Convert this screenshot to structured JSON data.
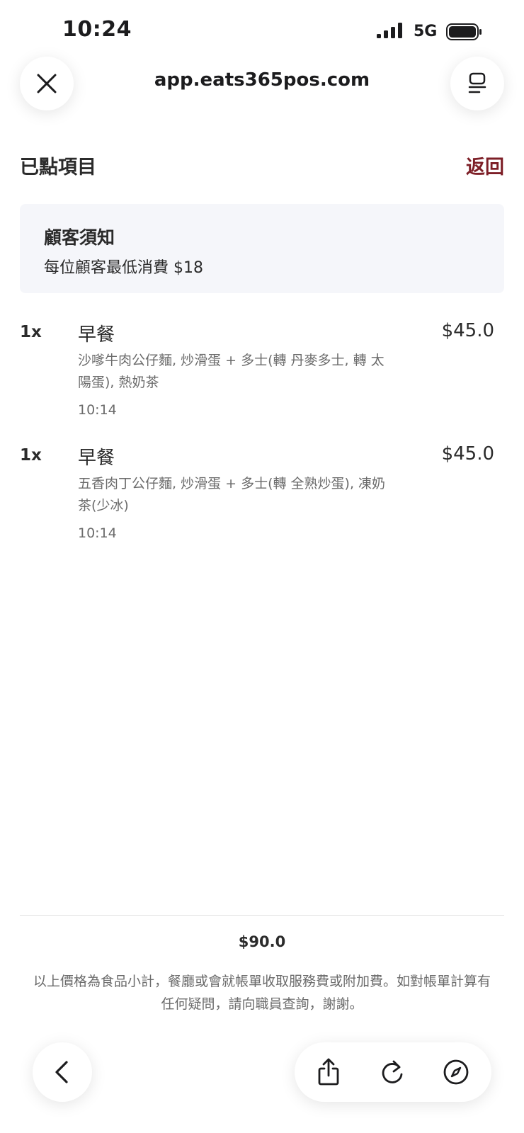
{
  "status_bar": {
    "time": "10:24",
    "network": "5G"
  },
  "browser": {
    "url": "app.eats365pos.com",
    "close_icon": "close-icon",
    "menu_icon": "page-menu-icon"
  },
  "header": {
    "title": "已點項目",
    "back_label": "返回"
  },
  "notice": {
    "title": "顧客須知",
    "text": "每位顧客最低消費 $18"
  },
  "items": [
    {
      "qty": "1x",
      "name": "早餐",
      "price": "$45.0",
      "description": "沙嗲牛肉公仔麵, 炒滑蛋 + 多士(轉 丹麥多士, 轉 太陽蛋), 熱奶茶",
      "time": "10:14"
    },
    {
      "qty": "1x",
      "name": "早餐",
      "price": "$45.0",
      "description": "五香肉丁公仔麵, 炒滑蛋 + 多士(轉 全熟炒蛋), 凍奶茶(少冰)",
      "time": "10:14"
    }
  ],
  "summary": {
    "total": "$90.0",
    "disclaimer": "以上價格為食品小計，餐廳或會就帳單收取服務費或附加費。如對帳單計算有任何疑問，請向職員查詢，謝謝。"
  },
  "toolbar": {
    "icons": [
      "back-arrow-icon",
      "share-icon",
      "reload-icon",
      "compass-icon"
    ]
  },
  "colors": {
    "accent": "#7d1f27",
    "card_bg": "#f5f6fa",
    "muted_text": "#6b6b6b"
  }
}
